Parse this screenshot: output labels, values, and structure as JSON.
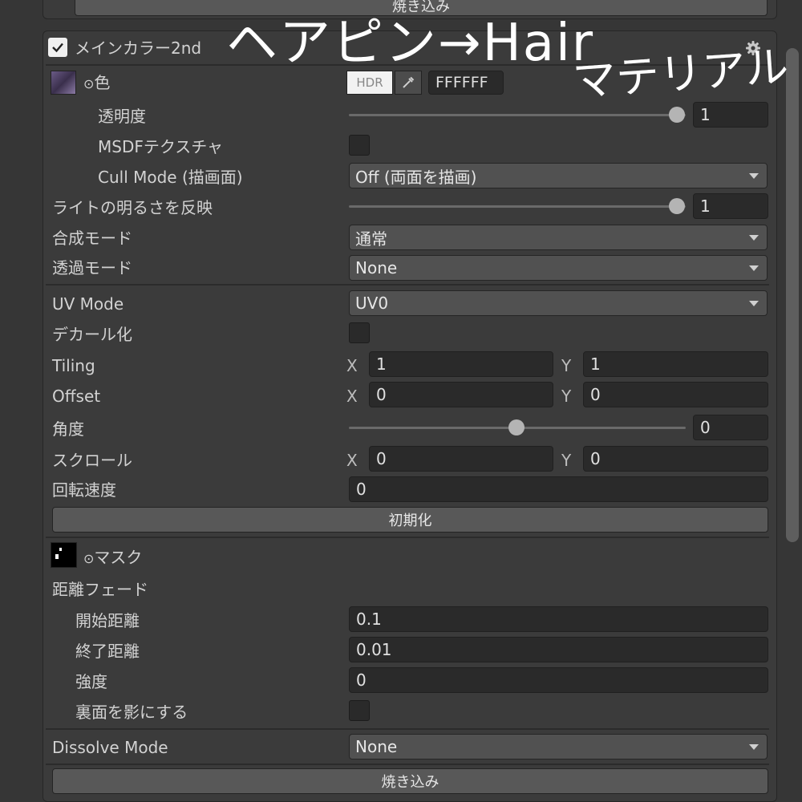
{
  "top_bake_button": "焼き込み",
  "section": {
    "title": "メインカラー2nd",
    "enabled": true
  },
  "color": {
    "label": "色",
    "hdr_label": "HDR",
    "hex": "FFFFFF"
  },
  "opacity": {
    "label": "透明度",
    "value": "1",
    "slider_fraction": 1.0
  },
  "msdf": {
    "label": "MSDFテクスチャ",
    "checked": false
  },
  "cull_mode": {
    "label": "Cull Mode (描画面)",
    "value": "Off (両面を描画)"
  },
  "light_reflect": {
    "label": "ライトの明るさを反映",
    "value": "1",
    "slider_fraction": 1.0
  },
  "blend_mode": {
    "label": "合成モード",
    "value": "通常"
  },
  "transparency_mode": {
    "label": "透過モード",
    "value": "None"
  },
  "uv_mode": {
    "label": "UV Mode",
    "value": "UV0"
  },
  "decal": {
    "label": "デカール化",
    "checked": false
  },
  "tiling": {
    "label": "Tiling",
    "x_label": "X",
    "x": "1",
    "y_label": "Y",
    "y": "1"
  },
  "offset": {
    "label": "Offset",
    "x_label": "X",
    "x": "0",
    "y_label": "Y",
    "y": "0"
  },
  "angle": {
    "label": "角度",
    "value": "0",
    "slider_fraction": 0.5
  },
  "scroll": {
    "label": "スクロール",
    "x_label": "X",
    "x": "0",
    "y_label": "Y",
    "y": "0"
  },
  "rotation_speed": {
    "label": "回転速度",
    "value": "0"
  },
  "reset_button": "初期化",
  "mask": {
    "label": "マスク"
  },
  "distance_fade": {
    "label": "距離フェード",
    "start": {
      "label": "開始距離",
      "value": "0.1"
    },
    "end": {
      "label": "終了距離",
      "value": "0.01"
    },
    "strength": {
      "label": "強度",
      "value": "0"
    },
    "backface_shadow": {
      "label": "裏面を影にする",
      "checked": false
    }
  },
  "dissolve_mode": {
    "label": "Dissolve Mode",
    "value": "None"
  },
  "bottom_bake_button": "焼き込み",
  "annotation": {
    "line1": "ヘアピン→Hair",
    "line2": "マテリアル"
  },
  "colors": {
    "background": "#363636",
    "panel": "#3b3b3b",
    "field": "#2a2a2a",
    "button": "#585858"
  }
}
